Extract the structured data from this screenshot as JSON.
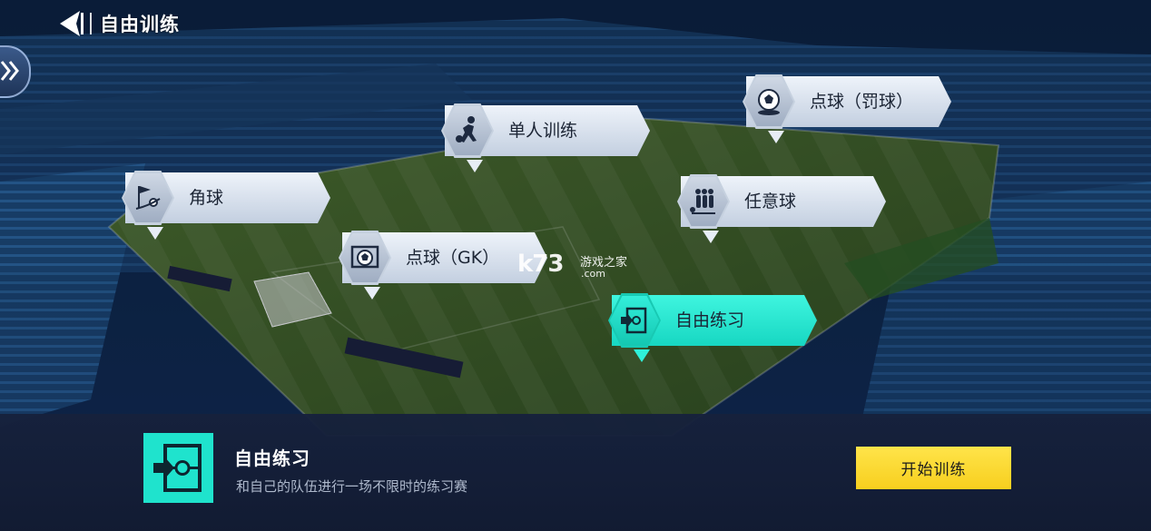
{
  "header": {
    "title": "自由训练"
  },
  "markers": [
    {
      "label": "点球（罚球）",
      "icon": "ball-icon"
    },
    {
      "label": "单人训练",
      "icon": "dribbling-player-icon"
    },
    {
      "label": "角球",
      "icon": "corner-flag-icon"
    },
    {
      "label": "任意球",
      "icon": "wall-players-icon"
    },
    {
      "label": "点球（GK）",
      "icon": "goalkeeper-ball-icon"
    },
    {
      "label": "自由练习",
      "icon": "free-practice-icon",
      "selected": true
    }
  ],
  "watermark": {
    "main": "k73",
    "sub": "游戏之家",
    "domain": ".com"
  },
  "detail": {
    "title": "自由练习",
    "description": "和自己的队伍进行一场不限时的练习赛",
    "start_button": "开始训练"
  },
  "colors": {
    "accent": "#1fe3cd",
    "button": "#f9d52a",
    "panel": "#16213c"
  }
}
